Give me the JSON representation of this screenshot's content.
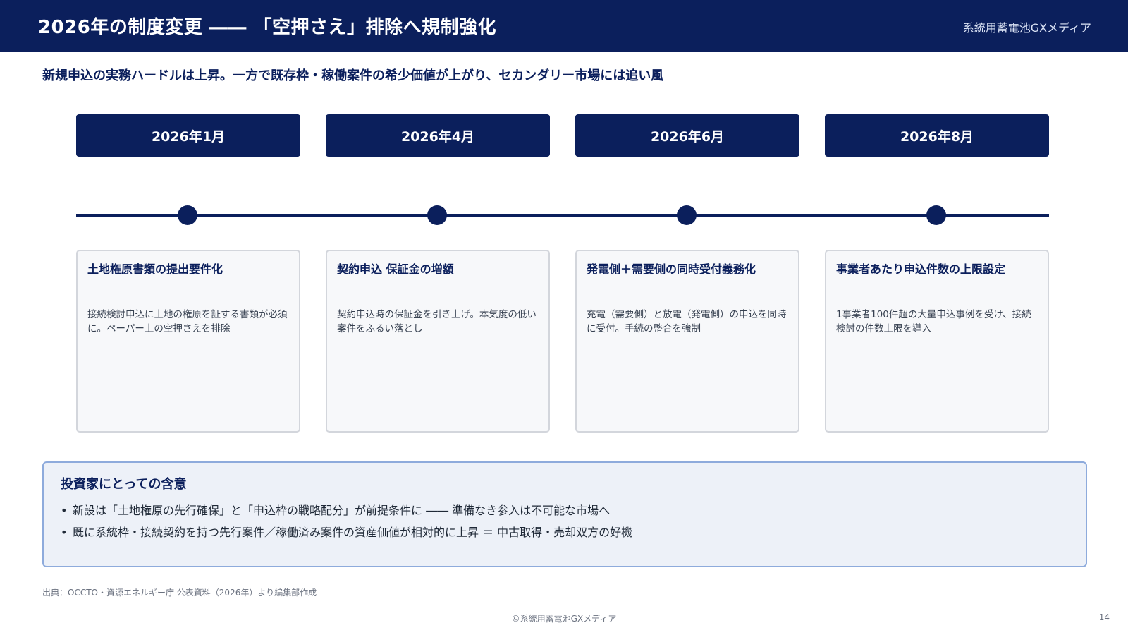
{
  "header": {
    "title": "2026年の制度変更 ―― 「空押さえ」排除へ規制強化",
    "brand": "系統用蓄電池GXメディア"
  },
  "subtitle": "新規申込の実務ハードルは上昇。一方で既存枠・稼働案件の希少価値が上がり、セカンダリー市場には追い風",
  "timeline": [
    {
      "date": "2026年1月",
      "title": "土地権原書類の提出要件化",
      "body": "接続検討申込に土地の権原を証する書類が必須に。ペーパー上の空押さえを排除"
    },
    {
      "date": "2026年4月",
      "title": "契約申込 保証金の増額",
      "body": "契約申込時の保証金を引き上げ。本気度の低い案件をふるい落とし"
    },
    {
      "date": "2026年6月",
      "title": "発電側＋需要側の同時受付義務化",
      "body": "充電（需要側）と放電（発電側）の申込を同時に受付。手続の整合を強制"
    },
    {
      "date": "2026年8月",
      "title": "事業者あたり申込件数の上限設定",
      "body": "1事業者100件超の大量申込事例を受け、接続検討の件数上限を導入"
    }
  ],
  "implications": {
    "title": "投資家にとっての含意",
    "items": [
      "新設は「土地権原の先行確保」と「申込枠の戦略配分」が前提条件に ―― 準備なき参入は不可能な市場へ",
      "既に系統枠・接続契約を持つ先行案件／稼働済み案件の資産価値が相対的に上昇 ＝ 中古取得・売却双方の好機"
    ],
    "bullet": "•"
  },
  "source": "出典：OCCTO・資源エネルギー庁 公表資料（2026年）より編集部作成",
  "footer": {
    "copyright": "©系統用蓄電池GXメディア",
    "page": "14"
  },
  "colors": {
    "navy": "#0b1f5c",
    "card_bg": "#f7f8fa",
    "implication_bg": "#edf1f8",
    "implication_border": "#8eabdc"
  }
}
